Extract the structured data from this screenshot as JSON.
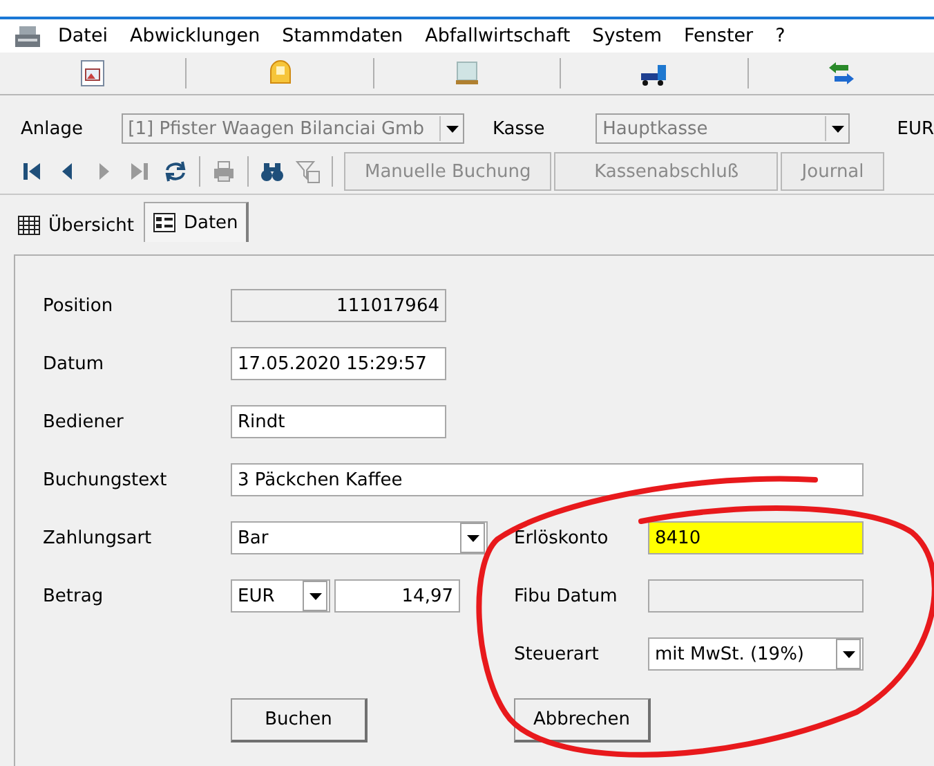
{
  "menu": [
    "Datei",
    "Abwicklungen",
    "Stammdaten",
    "Abfallwirtschaft",
    "System",
    "Fenster",
    "?"
  ],
  "toolbar": [
    {
      "kind": "document"
    },
    {
      "kind": "helmet"
    },
    {
      "kind": "pallet"
    },
    {
      "kind": "truck"
    },
    {
      "kind": "exchange"
    }
  ],
  "selector_bar": {
    "anlage_label": "Anlage",
    "anlage_value": "[1] Pfister Waagen Bilanciai Gmb",
    "anlage_disabled": true,
    "kasse_label": "Kasse",
    "kasse_value": "Hauptkasse",
    "kasse_disabled": true,
    "currency": "EUR"
  },
  "nav_toolbar": {
    "icons": [
      {
        "kind": "first",
        "disabled": false
      },
      {
        "kind": "prev",
        "disabled": false
      },
      {
        "kind": "next",
        "disabled": true
      },
      {
        "kind": "last",
        "disabled": true
      },
      {
        "kind": "refresh",
        "disabled": false
      },
      {
        "kind": "sep"
      },
      {
        "kind": "print",
        "disabled": true
      },
      {
        "kind": "sep"
      },
      {
        "kind": "binoculars",
        "disabled": false
      },
      {
        "kind": "filter",
        "disabled": true
      },
      {
        "kind": "sep"
      }
    ],
    "buttons": [
      {
        "label": "Manuelle Buchung",
        "disabled": true
      },
      {
        "label": "Kassenabschluß",
        "disabled": true
      },
      {
        "label": "Journal",
        "disabled": true
      }
    ]
  },
  "tabs": [
    {
      "label": "Übersicht",
      "selected": false
    },
    {
      "label": "Daten",
      "selected": true
    }
  ],
  "form": {
    "rows": [
      {
        "label": "Position",
        "field": {
          "kind": "readonly",
          "value": "111017964"
        }
      },
      {
        "label": "Datum",
        "field": {
          "kind": "text",
          "value": "17.05.2020 15:29:57"
        }
      },
      {
        "label": "Bediener",
        "field": {
          "kind": "text",
          "value": "Rindt"
        }
      },
      {
        "label": "Buchungstext",
        "field": {
          "kind": "wide",
          "value": "3 Päckchen Kaffee"
        }
      },
      {
        "label": "Zahlungsart",
        "field": {
          "kind": "combo",
          "value": "Bar"
        },
        "right_label": "Erlöskonto",
        "right_field": {
          "kind": "text",
          "value": "8410",
          "highlighted": true
        }
      },
      {
        "label": "Betrag",
        "field": {
          "kind": "amount",
          "currency": "EUR",
          "value": "14,97"
        },
        "right_label": "Fibu Datum",
        "right_field": {
          "kind": "readonly"
        }
      },
      {
        "right_label": "Steuerart",
        "right_field": {
          "kind": "combo",
          "value": "mit MwSt. (19%)"
        }
      }
    ],
    "buttons": [
      "Buchen",
      "Abbrechen"
    ]
  },
  "annotation": {
    "kind": "circle",
    "color": "#e8191c"
  }
}
